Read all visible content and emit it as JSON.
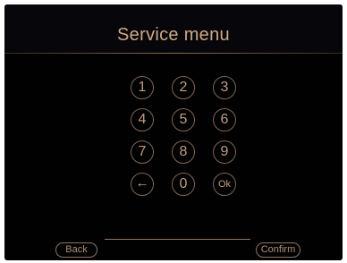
{
  "header": {
    "title": "Service menu"
  },
  "keypad": {
    "keys": [
      {
        "label": "1"
      },
      {
        "label": "2"
      },
      {
        "label": "3"
      },
      {
        "label": "4"
      },
      {
        "label": "5"
      },
      {
        "label": "6"
      },
      {
        "label": "7"
      },
      {
        "label": "8"
      },
      {
        "label": "9"
      },
      {
        "label": "←",
        "icon": "backspace-arrow-icon"
      },
      {
        "label": "0"
      },
      {
        "label": "Ok"
      }
    ]
  },
  "footer": {
    "back_label": "Back",
    "confirm_label": "Confirm"
  },
  "colors": {
    "background": "#010101",
    "accent_text": "#d0a886",
    "key_border": "#7d6657"
  }
}
